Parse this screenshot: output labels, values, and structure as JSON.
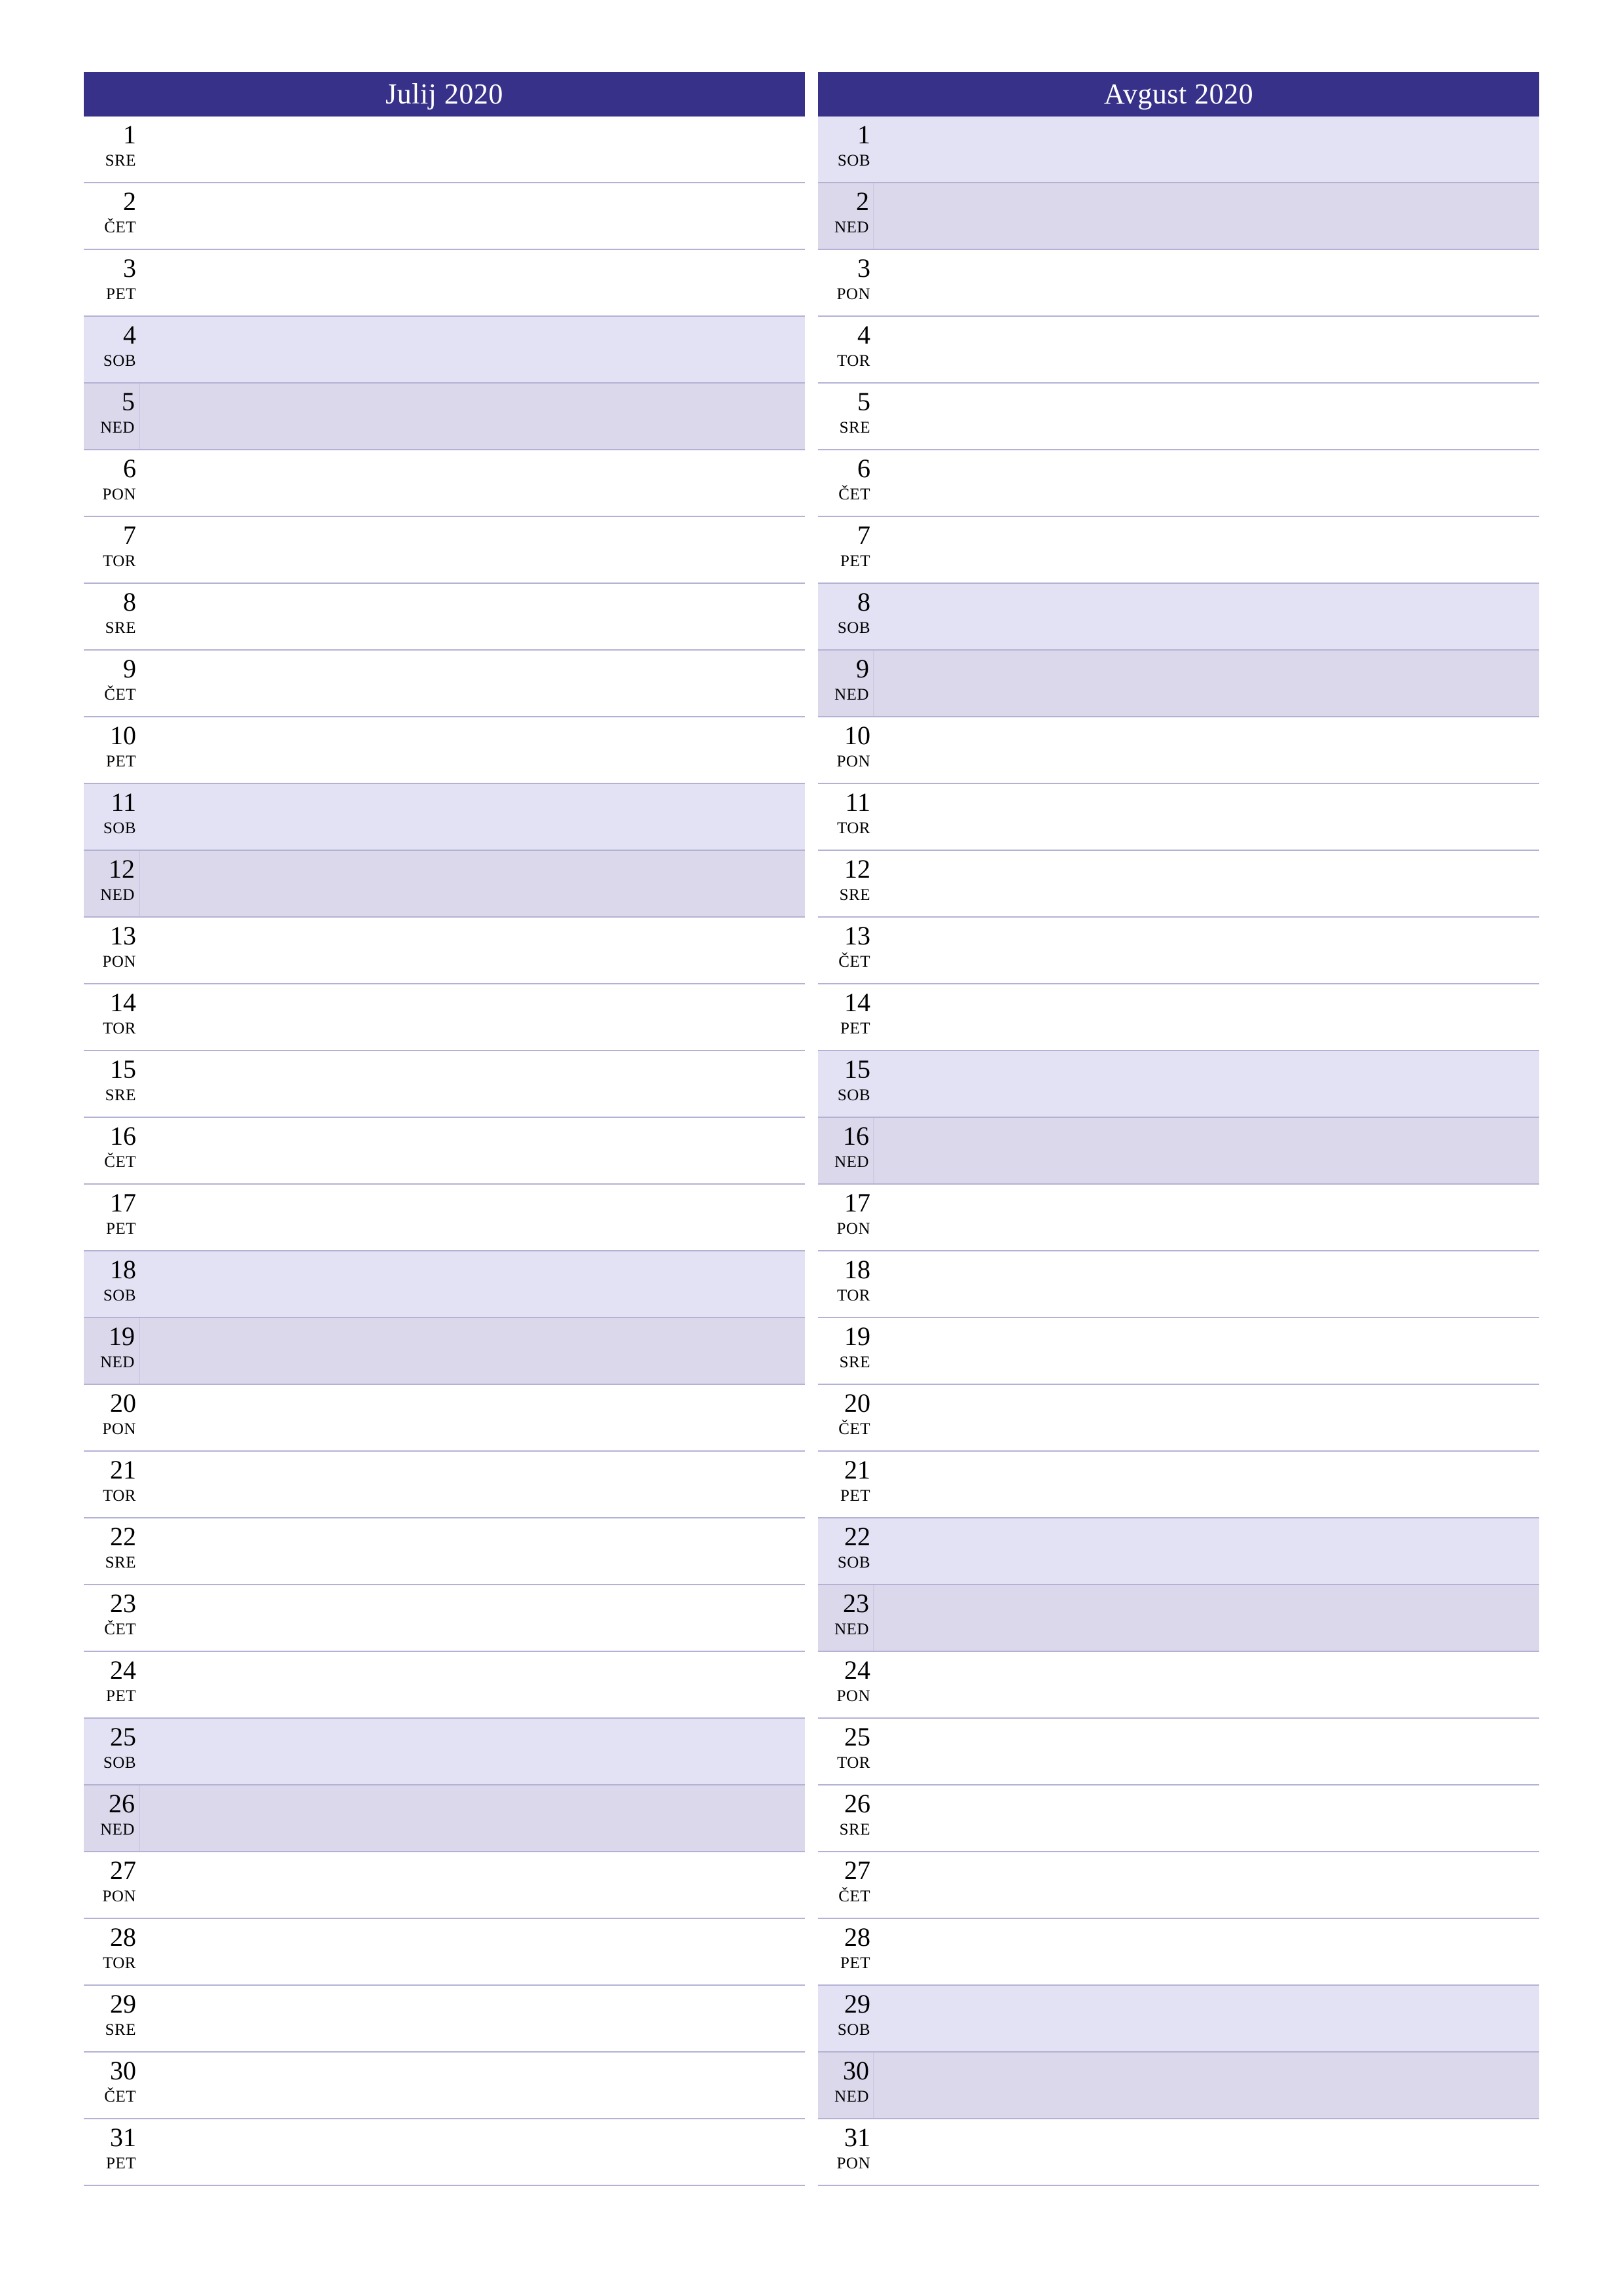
{
  "page": {
    "orientation": "portrait",
    "background_color": "#ffffff"
  },
  "theme": {
    "header_background": "#373189",
    "header_text_color": "#ffffff",
    "rule_color": "#b4b2d4",
    "saturday_background": "#e2e2f4",
    "sunday_background": "#dcd8ec",
    "text_color": "#000000"
  },
  "months": [
    {
      "title": "Julij 2020",
      "name": "Julij",
      "year": "2020",
      "days": [
        {
          "num": "1",
          "dow": "SRE"
        },
        {
          "num": "2",
          "dow": "ČET"
        },
        {
          "num": "3",
          "dow": "PET"
        },
        {
          "num": "4",
          "dow": "SOB"
        },
        {
          "num": "5",
          "dow": "NED"
        },
        {
          "num": "6",
          "dow": "PON"
        },
        {
          "num": "7",
          "dow": "TOR"
        },
        {
          "num": "8",
          "dow": "SRE"
        },
        {
          "num": "9",
          "dow": "ČET"
        },
        {
          "num": "10",
          "dow": "PET"
        },
        {
          "num": "11",
          "dow": "SOB"
        },
        {
          "num": "12",
          "dow": "NED"
        },
        {
          "num": "13",
          "dow": "PON"
        },
        {
          "num": "14",
          "dow": "TOR"
        },
        {
          "num": "15",
          "dow": "SRE"
        },
        {
          "num": "16",
          "dow": "ČET"
        },
        {
          "num": "17",
          "dow": "PET"
        },
        {
          "num": "18",
          "dow": "SOB"
        },
        {
          "num": "19",
          "dow": "NED"
        },
        {
          "num": "20",
          "dow": "PON"
        },
        {
          "num": "21",
          "dow": "TOR"
        },
        {
          "num": "22",
          "dow": "SRE"
        },
        {
          "num": "23",
          "dow": "ČET"
        },
        {
          "num": "24",
          "dow": "PET"
        },
        {
          "num": "25",
          "dow": "SOB"
        },
        {
          "num": "26",
          "dow": "NED"
        },
        {
          "num": "27",
          "dow": "PON"
        },
        {
          "num": "28",
          "dow": "TOR"
        },
        {
          "num": "29",
          "dow": "SRE"
        },
        {
          "num": "30",
          "dow": "ČET"
        },
        {
          "num": "31",
          "dow": "PET"
        }
      ]
    },
    {
      "title": "Avgust 2020",
      "name": "Avgust",
      "year": "2020",
      "days": [
        {
          "num": "1",
          "dow": "SOB"
        },
        {
          "num": "2",
          "dow": "NED"
        },
        {
          "num": "3",
          "dow": "PON"
        },
        {
          "num": "4",
          "dow": "TOR"
        },
        {
          "num": "5",
          "dow": "SRE"
        },
        {
          "num": "6",
          "dow": "ČET"
        },
        {
          "num": "7",
          "dow": "PET"
        },
        {
          "num": "8",
          "dow": "SOB"
        },
        {
          "num": "9",
          "dow": "NED"
        },
        {
          "num": "10",
          "dow": "PON"
        },
        {
          "num": "11",
          "dow": "TOR"
        },
        {
          "num": "12",
          "dow": "SRE"
        },
        {
          "num": "13",
          "dow": "ČET"
        },
        {
          "num": "14",
          "dow": "PET"
        },
        {
          "num": "15",
          "dow": "SOB"
        },
        {
          "num": "16",
          "dow": "NED"
        },
        {
          "num": "17",
          "dow": "PON"
        },
        {
          "num": "18",
          "dow": "TOR"
        },
        {
          "num": "19",
          "dow": "SRE"
        },
        {
          "num": "20",
          "dow": "ČET"
        },
        {
          "num": "21",
          "dow": "PET"
        },
        {
          "num": "22",
          "dow": "SOB"
        },
        {
          "num": "23",
          "dow": "NED"
        },
        {
          "num": "24",
          "dow": "PON"
        },
        {
          "num": "25",
          "dow": "TOR"
        },
        {
          "num": "26",
          "dow": "SRE"
        },
        {
          "num": "27",
          "dow": "ČET"
        },
        {
          "num": "28",
          "dow": "PET"
        },
        {
          "num": "29",
          "dow": "SOB"
        },
        {
          "num": "30",
          "dow": "NED"
        },
        {
          "num": "31",
          "dow": "PON"
        }
      ]
    }
  ]
}
